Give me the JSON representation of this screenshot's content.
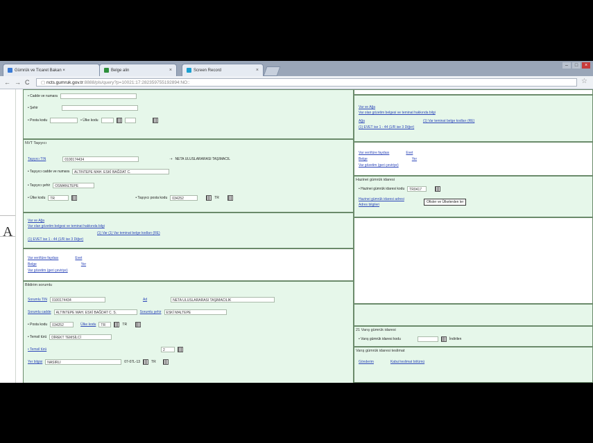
{
  "browser": {
    "tabs": [
      {
        "label": "Gümrük ve Ticaret Bakan ×",
        "color": "#3a7bd5"
      },
      {
        "label": "Belge alin",
        "color": "#2d8f3a"
      },
      {
        "label": "Screen Record",
        "color": "#1a9fd0"
      }
    ],
    "url_host": "ncts.gumruk.gov.tr",
    "url_rest": ":8888/pls/query?p=10021:17:282359755192894:NO::"
  },
  "left": {
    "top_box": {
      "cadde_label": "• Cadde ve numara",
      "sehir_label": "• Şehir",
      "posta_label": "• Posta kodu",
      "ulke_label": "• Ülke kodu"
    },
    "nvt": {
      "title": "NVT Taşıyıcı",
      "tasiyici_tin_label": "Taşıyıcı TIN",
      "tasiyici_tin_value": "0100174434",
      "tasiyici_name": "NETA ULUSLARARASI TAŞIMACIL",
      "cadde_label": "• Taşıyıcı cadde ve numara",
      "cadde_value": "ALTINTEPE MAH. ESKİ BAĞDAT C.",
      "sehir_label": "• Taşıyıcı şehir",
      "sehir_value": "OSMANLTEPE",
      "ulke_label": "• Ülke kodu",
      "ulke_value": "TR",
      "posta_label": "• Taşıyıcı posta kodu",
      "posta_value": "034252",
      "posta_ulke": "TR"
    },
    "links_box": {
      "l1": "Var ve Ağa",
      "l2": "Var olan gözetim belgesi ve teminat hakkında bilgi",
      "l3": "(1) Var (1) Var teminat belge kodları (RE)",
      "l4": "(1) EVET ise 1 - 44 (1/R ise 3 Diğer)"
    },
    "links2": {
      "l1": "Var veri/türe faydası",
      "l2": "Evet",
      "l3": "Belge",
      "l4": "Yer",
      "l5": "Var gözetim (geri çeviriye)"
    },
    "bildirim": {
      "title": "Bildirim sorumlu",
      "tin_label": "Sorumlu TIN",
      "tin_value": "0100174434",
      "ad_label": "Ad",
      "ad_value": "NETA ULUSLARARASI TAŞIMACILIK",
      "cadde_label": "Sorumlu cadde",
      "cadde_value": "ALTINTEPE MAH. ESKİ BAĞDAT C. S.",
      "sehir_label": "Sorumlu şehir",
      "sehir_value": "ESKİ MALTEPE",
      "posta_label": "• Posta kodu",
      "posta_value": "034252",
      "ulke_label": "Ülke kodu",
      "ulke_value": "TR",
      "tr2": "TR",
      "temsil_label": "• Temsil türü",
      "temsil_value": "DİREKT TEMSİLCİ",
      "temsil_code": "2",
      "yer_label": "Yer bilgisi",
      "yer_value": "NASIRLI",
      "date_value": "07-07L-13",
      "tr3": "TR"
    }
  },
  "right": {
    "links_top": {
      "l1": "Var ve Ağa",
      "l2": "Var olan gözetim belgesi ve teminat hakkında bilgi",
      "l3": "Ağa",
      "l4": "(1) Var teminat belge kodları (RE)",
      "l5": "(1) EVET ise 1 - 44 (1/R ise 3 Diğer)"
    },
    "links_mid": {
      "l1": "Var veri/türe faydası",
      "l2": "Evet",
      "l3": "Belge",
      "l4": "Yer",
      "l5": "Var gözetim (geri çeviriye)"
    },
    "hazinei": {
      "title": "Hazinei gümrük idaresi",
      "field_label": "• Hazinei gümrük idaresi kodu",
      "field_value": "TR0417",
      "tooltip": "Ofisler ve Ülkelerden ler",
      "link1": "Hazinei gümrük idaresi adresi",
      "link2": "Adres bilgileri"
    },
    "varis": {
      "title": "21 Varış gümrük idaresi",
      "field_label": "• Varış gümrük idaresi kodu",
      "field_suffix": "İndirilen"
    },
    "varis2": {
      "title": "Varış gümrük idaresi teslimat",
      "link1": "Gönderim",
      "link2": "Kabul teslimat bölümü"
    }
  },
  "colors": {
    "form_bg": "#e6f7ea",
    "form_border": "#6a8a6a",
    "link": "#2a44b8"
  }
}
